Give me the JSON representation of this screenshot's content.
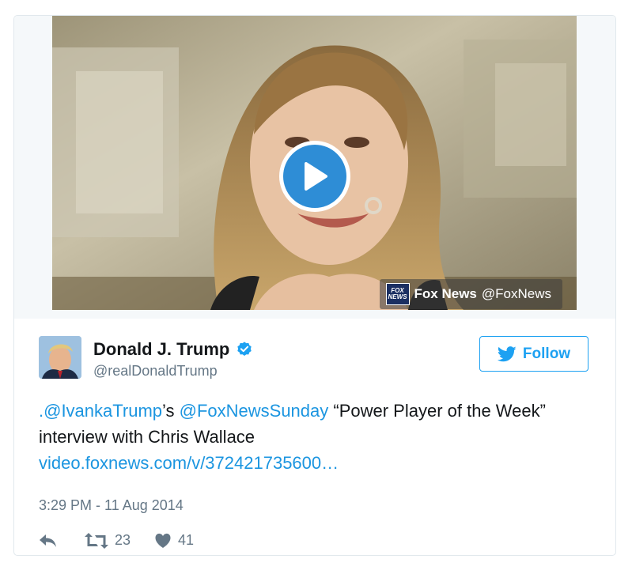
{
  "media": {
    "source_name": "Fox News",
    "source_handle": "@FoxNews",
    "logo_text_top": "FOX",
    "logo_text_bottom": "NEWS"
  },
  "author": {
    "display_name": "Donald J. Trump",
    "handle": "@realDonaldTrump",
    "verified": true
  },
  "follow_label": "Follow",
  "tweet": {
    "mention1": ".@IvankaTrump",
    "connector": "’s ",
    "mention2": "@FoxNewsSunday",
    "text_rest": " “Power Player of the Week” interview with Chris Wallace",
    "link": "video.foxnews.com/v/372421735600…"
  },
  "timestamp": "3:29 PM - 11 Aug 2014",
  "stats": {
    "retweets": "23",
    "likes": "41"
  },
  "colors": {
    "accent": "#1da1f2",
    "link": "#1b95e0",
    "play": "#2e8dd6",
    "muted": "#657786"
  }
}
